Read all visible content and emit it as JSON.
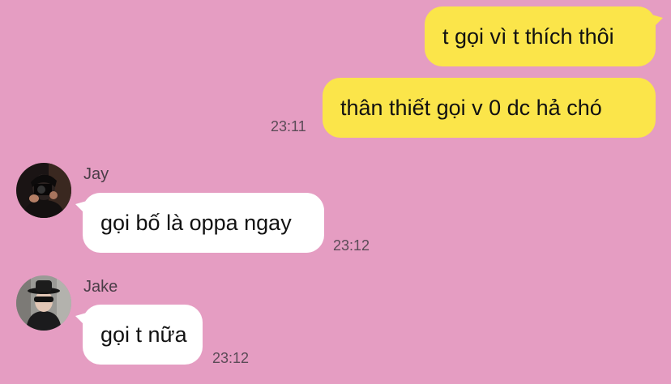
{
  "chat": {
    "messages": [
      {
        "sender": "me",
        "text": "t gọi vì t thích thôi"
      },
      {
        "sender": "me",
        "text": "thân thiết gọi v 0 dc hả chó",
        "time": "23:11"
      },
      {
        "sender": "Jay",
        "text": "gọi bố là oppa ngay",
        "time": "23:12",
        "avatar_icon": "person-with-camera-avatar"
      },
      {
        "sender": "Jake",
        "text": "gọi t nữa",
        "time": "23:12",
        "avatar_icon": "person-in-hat-avatar"
      }
    ]
  },
  "colors": {
    "background": "#e59dc2",
    "outgoing_bubble": "#fbe54a",
    "incoming_bubble": "#ffffff"
  }
}
